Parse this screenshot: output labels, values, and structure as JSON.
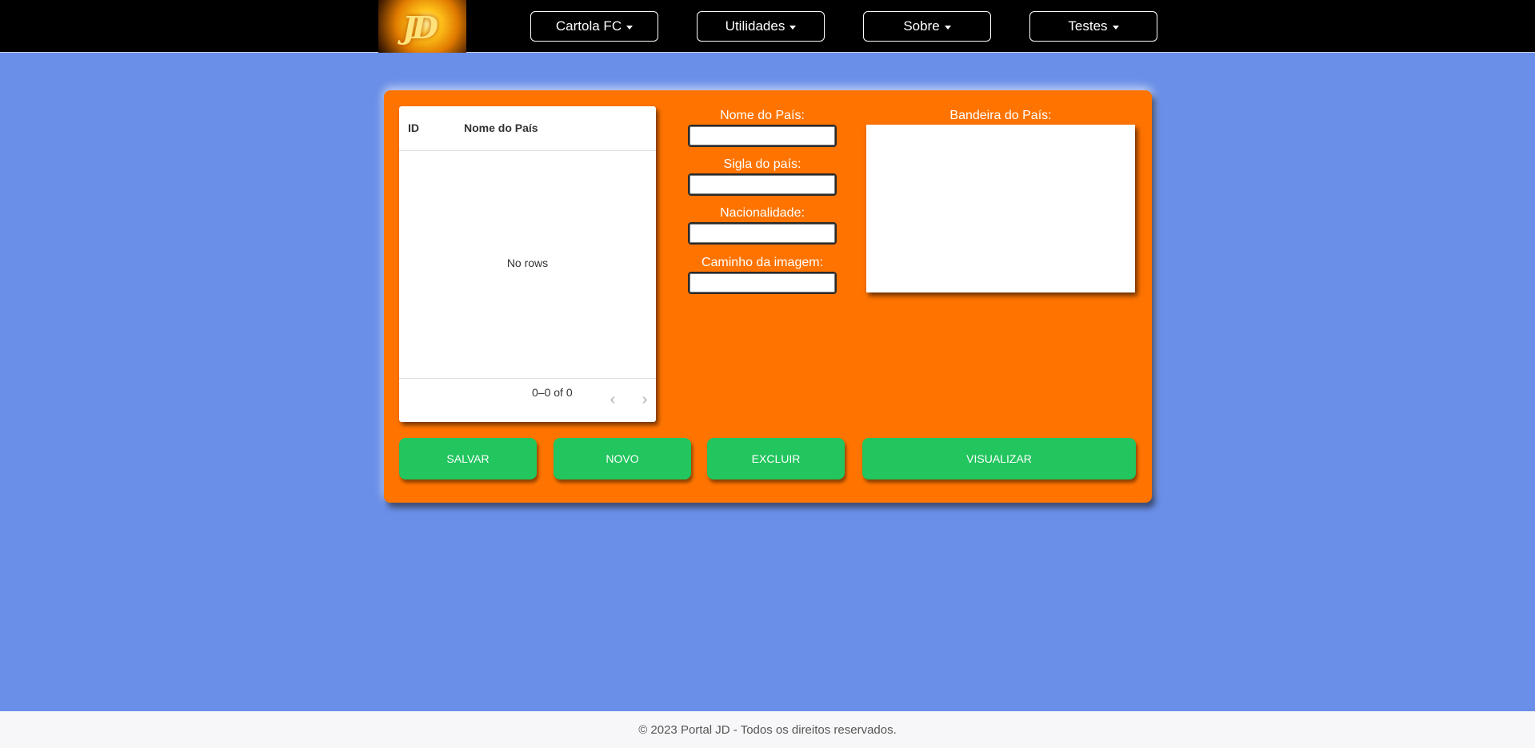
{
  "navbar": {
    "logo_text": "JD",
    "menus": [
      {
        "label": "Cartola FC"
      },
      {
        "label": "Utilidades"
      },
      {
        "label": "Sobre"
      },
      {
        "label": "Testes"
      }
    ]
  },
  "grid": {
    "columns": [
      "ID",
      "Nome do País"
    ],
    "empty_text": "No rows",
    "pagination": "0–0 of 0"
  },
  "form": {
    "nome_label": "Nome do País:",
    "nome_value": "",
    "sigla_label": "Sigla do país:",
    "sigla_value": "",
    "nacionalidade_label": "Nacionalidade:",
    "nacionalidade_value": "",
    "caminho_label": "Caminho da imagem:",
    "caminho_value": "",
    "bandeira_label": "Bandeira do País:"
  },
  "actions": {
    "salvar": "SALVAR",
    "novo": "NOVO",
    "excluir": "EXCLUIR",
    "visualizar": "VISUALIZAR"
  },
  "footer": {
    "text": "© 2023 Portal JD - Todos os direitos reservados."
  },
  "colors": {
    "background": "#6a8fe8",
    "panel": "#ff7400",
    "button": "#22c55e",
    "navbar": "#000000"
  }
}
